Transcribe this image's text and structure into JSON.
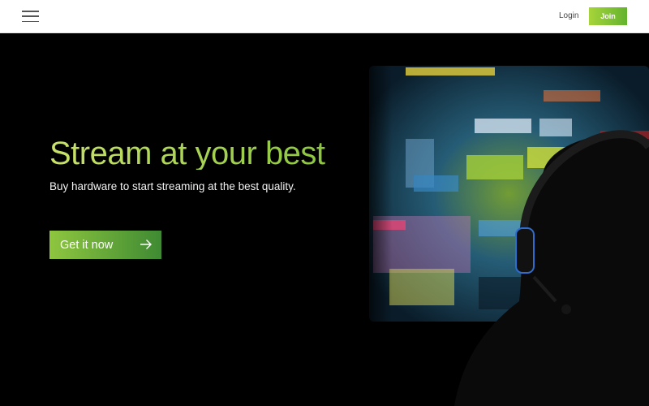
{
  "header": {
    "menu_icon": "hamburger-menu-icon",
    "login_label": "Login",
    "join_label": "Join",
    "join_color": "#7dc030"
  },
  "hero": {
    "headline": "Stream at your best",
    "subheadline": "Buy hardware to start streaming at the best quality.",
    "cta_label": "Get it now",
    "cta_icon": "arrow-right-icon",
    "accent_color": "#8cc63f"
  }
}
